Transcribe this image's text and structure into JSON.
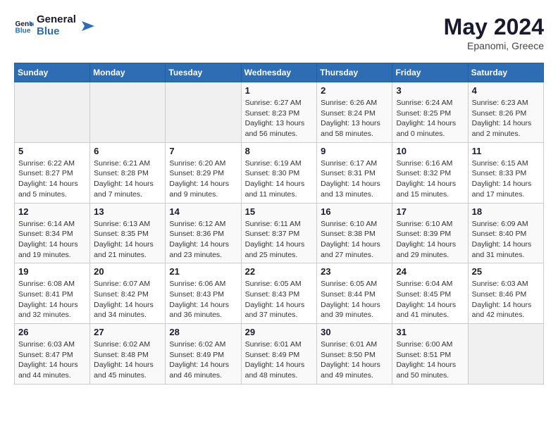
{
  "logo": {
    "text_general": "General",
    "text_blue": "Blue"
  },
  "header": {
    "month_year": "May 2024",
    "location": "Epanomi, Greece"
  },
  "weekdays": [
    "Sunday",
    "Monday",
    "Tuesday",
    "Wednesday",
    "Thursday",
    "Friday",
    "Saturday"
  ],
  "weeks": [
    [
      {
        "day": "",
        "info": ""
      },
      {
        "day": "",
        "info": ""
      },
      {
        "day": "",
        "info": ""
      },
      {
        "day": "1",
        "info": "Sunrise: 6:27 AM\nSunset: 8:23 PM\nDaylight: 13 hours and 56 minutes."
      },
      {
        "day": "2",
        "info": "Sunrise: 6:26 AM\nSunset: 8:24 PM\nDaylight: 13 hours and 58 minutes."
      },
      {
        "day": "3",
        "info": "Sunrise: 6:24 AM\nSunset: 8:25 PM\nDaylight: 14 hours and 0 minutes."
      },
      {
        "day": "4",
        "info": "Sunrise: 6:23 AM\nSunset: 8:26 PM\nDaylight: 14 hours and 2 minutes."
      }
    ],
    [
      {
        "day": "5",
        "info": "Sunrise: 6:22 AM\nSunset: 8:27 PM\nDaylight: 14 hours and 5 minutes."
      },
      {
        "day": "6",
        "info": "Sunrise: 6:21 AM\nSunset: 8:28 PM\nDaylight: 14 hours and 7 minutes."
      },
      {
        "day": "7",
        "info": "Sunrise: 6:20 AM\nSunset: 8:29 PM\nDaylight: 14 hours and 9 minutes."
      },
      {
        "day": "8",
        "info": "Sunrise: 6:19 AM\nSunset: 8:30 PM\nDaylight: 14 hours and 11 minutes."
      },
      {
        "day": "9",
        "info": "Sunrise: 6:17 AM\nSunset: 8:31 PM\nDaylight: 14 hours and 13 minutes."
      },
      {
        "day": "10",
        "info": "Sunrise: 6:16 AM\nSunset: 8:32 PM\nDaylight: 14 hours and 15 minutes."
      },
      {
        "day": "11",
        "info": "Sunrise: 6:15 AM\nSunset: 8:33 PM\nDaylight: 14 hours and 17 minutes."
      }
    ],
    [
      {
        "day": "12",
        "info": "Sunrise: 6:14 AM\nSunset: 8:34 PM\nDaylight: 14 hours and 19 minutes."
      },
      {
        "day": "13",
        "info": "Sunrise: 6:13 AM\nSunset: 8:35 PM\nDaylight: 14 hours and 21 minutes."
      },
      {
        "day": "14",
        "info": "Sunrise: 6:12 AM\nSunset: 8:36 PM\nDaylight: 14 hours and 23 minutes."
      },
      {
        "day": "15",
        "info": "Sunrise: 6:11 AM\nSunset: 8:37 PM\nDaylight: 14 hours and 25 minutes."
      },
      {
        "day": "16",
        "info": "Sunrise: 6:10 AM\nSunset: 8:38 PM\nDaylight: 14 hours and 27 minutes."
      },
      {
        "day": "17",
        "info": "Sunrise: 6:10 AM\nSunset: 8:39 PM\nDaylight: 14 hours and 29 minutes."
      },
      {
        "day": "18",
        "info": "Sunrise: 6:09 AM\nSunset: 8:40 PM\nDaylight: 14 hours and 31 minutes."
      }
    ],
    [
      {
        "day": "19",
        "info": "Sunrise: 6:08 AM\nSunset: 8:41 PM\nDaylight: 14 hours and 32 minutes."
      },
      {
        "day": "20",
        "info": "Sunrise: 6:07 AM\nSunset: 8:42 PM\nDaylight: 14 hours and 34 minutes."
      },
      {
        "day": "21",
        "info": "Sunrise: 6:06 AM\nSunset: 8:43 PM\nDaylight: 14 hours and 36 minutes."
      },
      {
        "day": "22",
        "info": "Sunrise: 6:05 AM\nSunset: 8:43 PM\nDaylight: 14 hours and 37 minutes."
      },
      {
        "day": "23",
        "info": "Sunrise: 6:05 AM\nSunset: 8:44 PM\nDaylight: 14 hours and 39 minutes."
      },
      {
        "day": "24",
        "info": "Sunrise: 6:04 AM\nSunset: 8:45 PM\nDaylight: 14 hours and 41 minutes."
      },
      {
        "day": "25",
        "info": "Sunrise: 6:03 AM\nSunset: 8:46 PM\nDaylight: 14 hours and 42 minutes."
      }
    ],
    [
      {
        "day": "26",
        "info": "Sunrise: 6:03 AM\nSunset: 8:47 PM\nDaylight: 14 hours and 44 minutes."
      },
      {
        "day": "27",
        "info": "Sunrise: 6:02 AM\nSunset: 8:48 PM\nDaylight: 14 hours and 45 minutes."
      },
      {
        "day": "28",
        "info": "Sunrise: 6:02 AM\nSunset: 8:49 PM\nDaylight: 14 hours and 46 minutes."
      },
      {
        "day": "29",
        "info": "Sunrise: 6:01 AM\nSunset: 8:49 PM\nDaylight: 14 hours and 48 minutes."
      },
      {
        "day": "30",
        "info": "Sunrise: 6:01 AM\nSunset: 8:50 PM\nDaylight: 14 hours and 49 minutes."
      },
      {
        "day": "31",
        "info": "Sunrise: 6:00 AM\nSunset: 8:51 PM\nDaylight: 14 hours and 50 minutes."
      },
      {
        "day": "",
        "info": ""
      }
    ]
  ]
}
